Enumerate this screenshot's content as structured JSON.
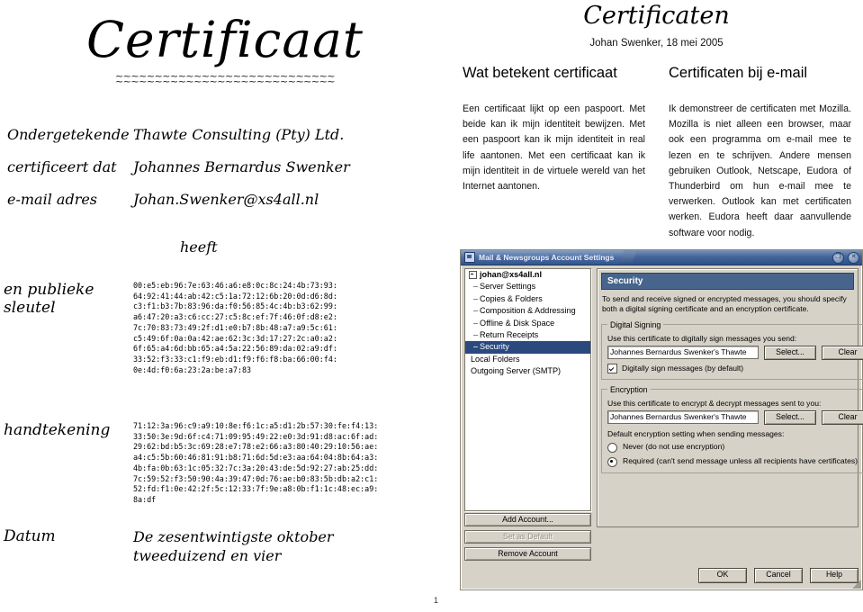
{
  "certificate": {
    "title": "Certificaat",
    "squiggle": "~~~~~~~~~~~~~~~~~~~~~~~~~~~~",
    "rows": [
      {
        "label": "Ondergetekende",
        "value": "Thawte Consulting (Pty) Ltd."
      },
      {
        "label": "certificeert dat",
        "value": "Johannes Bernardus Swenker"
      },
      {
        "label": "e-mail adres",
        "value": "Johan.Swenker@xs4all.nl"
      }
    ],
    "heeft": "heeft",
    "public_key_label": "en publieke\nsleutel",
    "public_key_label_line1": "en publieke",
    "public_key_label_line2": "sleutel",
    "public_key_hex": "00:e5:eb:96:7e:63:46:a6:e8:0c:8c:24:4b:73:93:\n64:92:41:44:ab:42:c5:1a:72:12:6b:20:0d:d6:8d:\nc3:f1:b3:7b:83:96:da:f0:56:85:4c:4b:b3:62:99:\na6:47:20:a3:c6:cc:27:c5:8c:ef:7f:46:0f:d8:e2:\n7c:70:83:73:49:2f:d1:e0:b7:8b:48:a7:a9:5c:61:\nc5:49:6f:0a:0a:42:ae:62:3c:3d:17:27:2c:a0:a2:\n6f:65:a4:6d:bb:65:a4:5a:22:56:89:da:02:a9:df:\n33:52:f3:33:c1:f9:eb:d1:f9:f6:f8:ba:66:00:f4:\n0e:4d:f0:6a:23:2a:be:a7:83",
    "signature_label": "handtekening",
    "signature_hex": "71:12:3a:96:c9:a9:10:8e:f6:1c:a5:d1:2b:57:30:fe:f4:13:\n33:50:3e:9d:6f:c4:71:09:95:49:22:e0:3d:91:d8:ac:6f:ad:\n29:62:bd:b5:3c:69:28:e7:78:e2:66:a3:80:40:29:10:56:ae:\na4:c5:5b:60:46:81:91:b8:71:6d:5d:e3:aa:64:04:8b:64:a3:\n4b:fa:0b:63:1c:05:32:7c:3a:20:43:de:5d:92:27:ab:25:dd:\n7c:59:52:f3:50:90:4a:39:47:0d:76:ae:b0:83:5b:db:a2:c1:\n52:fd:f1:0e:42:2f:5c:12:33:7f:9e:a8:0b:f1:1c:48:ec:a9:\n8a:df",
    "date_label": "Datum",
    "date_value_line1": "De zesentwintigste oktober",
    "date_value_line2": "tweeduizend en vier"
  },
  "slide": {
    "title": "Certificaten",
    "subtitle": "Johan Swenker, 18 mei 2005",
    "columns": [
      {
        "heading": "Wat betekent certificaat",
        "body": "Een certificaat lijkt op een paspoort. Met beide kan ik mijn identiteit bewijzen. Met een paspoort kan ik mijn identiteit in real life aantonen. Met een certificaat kan ik mijn identiteit in de virtuele wereld van het Internet aantonen."
      },
      {
        "heading": "Certificaten bij e-mail",
        "body": "Ik demonstreer de certificaten met Mozilla. Mozilla is niet alleen een browser, maar ook een programma om e-mail mee te lezen en te schrijven. Andere mensen gebruiken Outlook, Netscape, Eudora of Thunderbird om hun e-mail mee te verwerken. Outlook kan met certificaten werken. Eudora heeft daar aanvullende software voor nodig."
      }
    ],
    "page_number": "1"
  },
  "dialog": {
    "title": "Mail & Newsgroups Account Settings",
    "window_buttons": {
      "maximize": "❐",
      "close": "✕"
    },
    "tree": [
      {
        "label": "johan@xs4all.nl",
        "level": 0,
        "selected": false,
        "expander": true
      },
      {
        "label": "Server Settings",
        "level": 1,
        "selected": false
      },
      {
        "label": "Copies & Folders",
        "level": 1,
        "selected": false
      },
      {
        "label": "Composition & Addressing",
        "level": 1,
        "selected": false
      },
      {
        "label": "Offline & Disk Space",
        "level": 1,
        "selected": false
      },
      {
        "label": "Return Receipts",
        "level": 1,
        "selected": false
      },
      {
        "label": "Security",
        "level": 1,
        "selected": true
      },
      {
        "label": "Local Folders",
        "level": 0,
        "selected": false
      },
      {
        "label": "Outgoing Server (SMTP)",
        "level": 0,
        "selected": false
      }
    ],
    "account_buttons": [
      {
        "label": "Add Account...",
        "disabled": false
      },
      {
        "label": "Set as Default",
        "disabled": true
      },
      {
        "label": "Remove Account",
        "disabled": false
      }
    ],
    "panel": {
      "header": "Security",
      "description": "To send and receive signed or encrypted messages, you should specify both a digital signing certificate and an encryption certificate.",
      "digital_signing": {
        "legend": "Digital Signing",
        "field_label": "Use this certificate to digitally sign messages you send:",
        "certificate_value": "Johannes Bernardus Swenker's Thawte",
        "select_button": "Select...",
        "clear_button": "Clear",
        "checkbox_label": "Digitally sign messages (by default)",
        "checkbox_checked": true
      },
      "encryption": {
        "legend": "Encryption",
        "field_label": "Use this certificate to encrypt & decrypt messages sent to you:",
        "certificate_value": "Johannes Bernardus Swenker's Thawte",
        "select_button": "Select...",
        "clear_button": "Clear",
        "default_label": "Default encryption setting when sending messages:",
        "options": [
          {
            "label": "Never (do not use encryption)",
            "selected": false
          },
          {
            "label": "Required (can't send message unless all recipients have certificates)",
            "selected": true
          }
        ]
      }
    },
    "footer_buttons": [
      {
        "label": "OK"
      },
      {
        "label": "Cancel"
      },
      {
        "label": "Help"
      }
    ]
  }
}
